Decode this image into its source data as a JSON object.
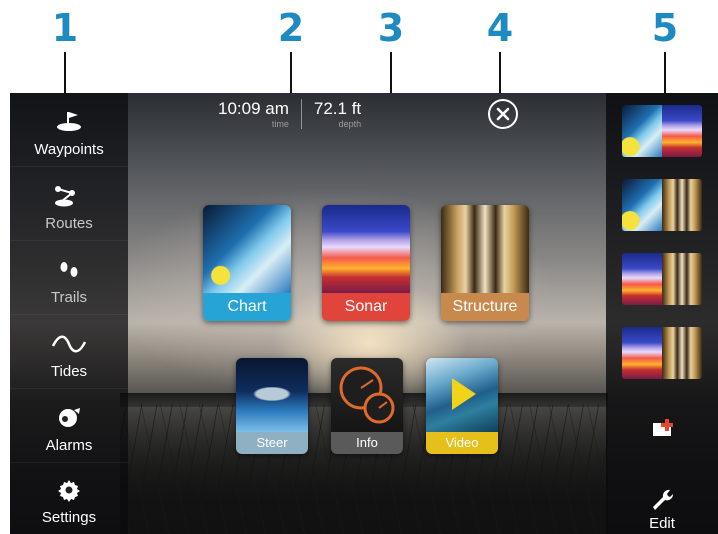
{
  "callouts": [
    "1",
    "2",
    "3",
    "4",
    "5"
  ],
  "status": {
    "time_value": "10:09 am",
    "time_label": "time",
    "depth_value": "72.1 ft",
    "depth_label": "depth"
  },
  "sidebar": {
    "items": [
      {
        "label": "Waypoints",
        "icon": "waypoint-icon"
      },
      {
        "label": "Routes",
        "icon": "route-icon"
      },
      {
        "label": "Trails",
        "icon": "footprints-icon"
      },
      {
        "label": "Tides",
        "icon": "sine-wave-icon"
      },
      {
        "label": "Alarms",
        "icon": "alarm-icon"
      },
      {
        "label": "Settings",
        "icon": "gear-icon"
      }
    ]
  },
  "apps": {
    "tiles": [
      {
        "label": "Chart",
        "color": "#27a4d6"
      },
      {
        "label": "Sonar",
        "color": "#e0443a"
      },
      {
        "label": "Structure",
        "color": "#c8894c"
      },
      {
        "label": "Steer",
        "color": "#8fb0c3"
      },
      {
        "label": "Info",
        "color": "#5a5a5a"
      },
      {
        "label": "Video",
        "color": "#e6c01a"
      }
    ]
  },
  "rightbar": {
    "panels": [
      {
        "name": "chart-sonar-favorite"
      },
      {
        "name": "chart-structure-favorite"
      },
      {
        "name": "sonar-structure-favorite"
      },
      {
        "name": "sonar-structure-split-favorite"
      }
    ],
    "edit_label": "Edit"
  },
  "colors": {
    "callout": "#1d8bc0",
    "sidebar_bg": "#0a0a0c"
  }
}
